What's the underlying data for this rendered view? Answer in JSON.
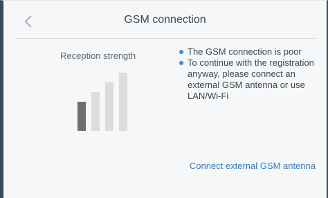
{
  "header": {
    "title": "GSM connection",
    "back_icon": "chevron-left-icon"
  },
  "signal": {
    "label": "Reception strength",
    "bars_total": 4,
    "bars_active": 1,
    "active_color": "#707070",
    "inactive_color": "#dcdcdc"
  },
  "info": {
    "items": [
      "The GSM connection is poor",
      "To continue with the registration anyway, please connect an external GSM antenna or use LAN/Wi-Fi"
    ],
    "bullet_color": "#3a8fd1"
  },
  "actions": {
    "connect_label": "Connect external GSM antenna",
    "link_color": "#2f7ec6"
  }
}
